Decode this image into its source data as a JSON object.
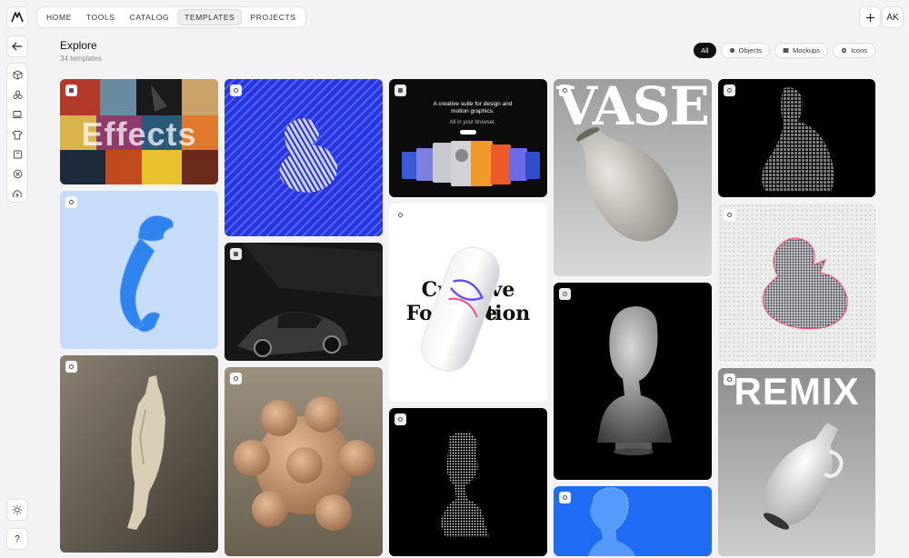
{
  "topbar": {
    "nav": [
      "HOME",
      "TOOLS",
      "CATALOG",
      "TEMPLATES",
      "PROJECTS"
    ],
    "active": "TEMPLATES",
    "avatar": "AK"
  },
  "sidebar": {
    "help": "?"
  },
  "header": {
    "title": "Explore",
    "subtitle": "34 templates"
  },
  "filters": {
    "all": "All",
    "objects": "Objects",
    "mockups": "Mockups",
    "icons": "Icons"
  },
  "cards": {
    "effects": "Effects",
    "suite_title": "A creative suite for design and motion graphics.",
    "suite_sub": "All in your browser.",
    "poster_line1": "Creative Suite",
    "poster_line2": "For Motion",
    "vase": "VASE",
    "remix": "REMIX"
  },
  "colors": {
    "blue": "#2a33e0",
    "light_blue": "#c7dcf8",
    "bright_blue": "#1f6df5",
    "page_bg": "#f3f3f5"
  }
}
